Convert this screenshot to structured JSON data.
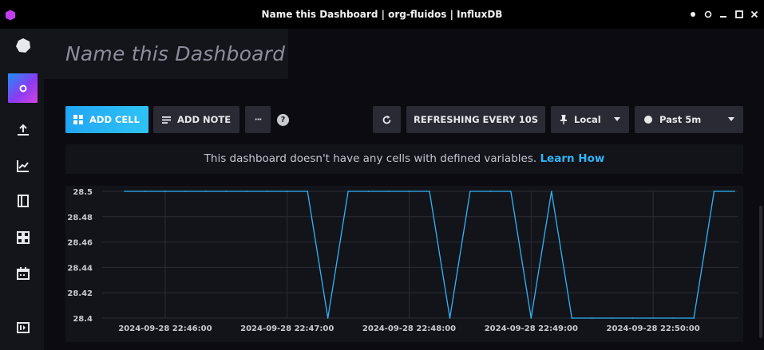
{
  "window": {
    "title": "Name this Dashboard | org-fluidos | InfluxDB",
    "controls": [
      "options-dot",
      "pin",
      "minimize",
      "maximize",
      "close"
    ]
  },
  "sidebar": {
    "items": [
      {
        "name": "logo",
        "icon": "influx-logo-icon",
        "active": false
      },
      {
        "name": "user",
        "icon": "user-circle-icon",
        "active": true
      },
      {
        "name": "upload",
        "icon": "upload-icon",
        "active": false
      },
      {
        "name": "data-explorer",
        "icon": "graph-line-icon",
        "active": false
      },
      {
        "name": "notebooks",
        "icon": "book-icon",
        "active": false
      },
      {
        "name": "dashboards",
        "icon": "grid-icon",
        "active": false
      },
      {
        "name": "tasks",
        "icon": "calendar-icon",
        "active": false
      },
      {
        "name": "collapse",
        "icon": "collapse-icon",
        "active": false
      }
    ]
  },
  "dashboard": {
    "title_placeholder": "Name this Dashboard"
  },
  "toolbar": {
    "add_cell": "ADD CELL",
    "add_note": "ADD NOTE",
    "more": "···",
    "help": "?",
    "refreshing": "REFRESHING EVERY 10S",
    "timezone": "Local",
    "time_range": "Past 5m"
  },
  "notice": {
    "text": "This dashboard doesn't have any cells with defined variables.",
    "link": "Learn How"
  },
  "colors": {
    "accent": "#2ec3f4",
    "line": "#2fb5f6",
    "background": "#0b0b11",
    "panel": "#13131a"
  },
  "chart_data": {
    "type": "line",
    "ylim": [
      28.4,
      28.5
    ],
    "yticks": [
      "28.5",
      "28.48",
      "28.46",
      "28.44",
      "28.42",
      "28.4"
    ],
    "xticks": [
      "2024-09-28 22:46:00",
      "2024-09-28 22:47:00",
      "2024-09-28 22:48:00",
      "2024-09-28 22:49:00",
      "2024-09-28 22:50:00"
    ],
    "grid": true,
    "series": [
      {
        "x": [
          "22:45:40",
          "22:45:50",
          "22:46:00",
          "22:46:10",
          "22:46:20",
          "22:46:30",
          "22:46:40",
          "22:46:50",
          "22:47:00",
          "22:47:10",
          "22:47:20",
          "22:47:30",
          "22:47:40",
          "22:47:50",
          "22:48:00",
          "22:48:10",
          "22:48:20",
          "22:48:30",
          "22:48:40",
          "22:48:50",
          "22:49:00",
          "22:49:10",
          "22:49:20",
          "22:49:30",
          "22:49:40",
          "22:49:50",
          "22:50:00",
          "22:50:10",
          "22:50:20",
          "22:50:30",
          "22:50:40"
        ],
        "y": [
          28.5,
          28.5,
          28.5,
          28.5,
          28.5,
          28.5,
          28.5,
          28.5,
          28.5,
          28.5,
          28.4,
          28.5,
          28.5,
          28.5,
          28.5,
          28.5,
          28.4,
          28.5,
          28.5,
          28.5,
          28.4,
          28.5,
          28.4,
          28.4,
          28.4,
          28.4,
          28.4,
          28.4,
          28.4,
          28.5,
          28.5
        ]
      }
    ]
  }
}
